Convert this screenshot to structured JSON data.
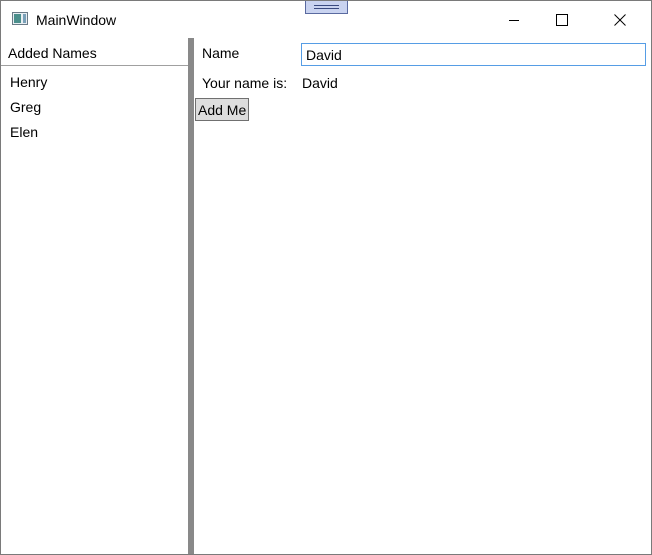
{
  "window": {
    "title": "MainWindow",
    "icon": "app-window-icon",
    "controls": {
      "minimize_icon": "minimize-icon",
      "maximize_icon": "maximize-icon",
      "close_icon": "close-icon"
    }
  },
  "left_panel": {
    "header": "Added Names",
    "names": [
      "Henry",
      "Greg",
      "Elen"
    ]
  },
  "right_panel": {
    "name_label": "Name",
    "name_value": "David",
    "your_name_label": "Your name is:",
    "your_name_value": "David",
    "add_button_label": "Add Me"
  },
  "colors": {
    "input_border": "#569de5",
    "splitter": "#898989",
    "button_bg": "#dddddd"
  }
}
